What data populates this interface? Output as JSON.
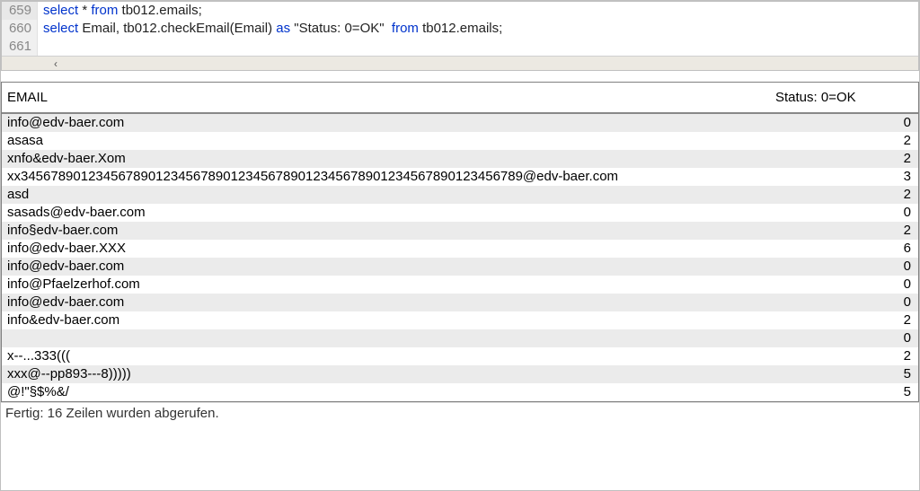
{
  "editor": {
    "lines": [
      {
        "num": "659",
        "tokens": [
          {
            "t": "select",
            "c": "kw"
          },
          {
            "t": " * ",
            "c": "plain"
          },
          {
            "t": "from",
            "c": "kw"
          },
          {
            "t": " tb012.emails;",
            "c": "plain"
          }
        ]
      },
      {
        "num": "660",
        "tokens": [
          {
            "t": "select",
            "c": "kw"
          },
          {
            "t": " Email, tb012.checkEmail(Email) ",
            "c": "plain"
          },
          {
            "t": "as",
            "c": "kw"
          },
          {
            "t": " \"Status: 0=OK\"  ",
            "c": "str"
          },
          {
            "t": "from",
            "c": "kw"
          },
          {
            "t": " tb012.emails;",
            "c": "plain"
          }
        ]
      },
      {
        "num": "661",
        "tokens": []
      }
    ],
    "scroll_glyph": "‹"
  },
  "grid": {
    "columns": {
      "email": "EMAIL",
      "status": "Status: 0=OK"
    },
    "rows": [
      {
        "email": "info@edv-baer.com",
        "status": "0"
      },
      {
        "email": "asasa",
        "status": "2"
      },
      {
        "email": "xnfo&edv-baer.Xom",
        "status": "2"
      },
      {
        "email": "xx3456789012345678901234567890123456789012345678901234567890123456789@edv-baer.com",
        "status": "3"
      },
      {
        "email": "asd",
        "status": "2"
      },
      {
        "email": "sasads@edv-baer.com",
        "status": "0"
      },
      {
        "email": "info§edv-baer.com",
        "status": "2"
      },
      {
        "email": "info@edv-baer.XXX",
        "status": "6"
      },
      {
        "email": "info@edv-baer.com",
        "status": "0"
      },
      {
        "email": "info@Pfaelzerhof.com",
        "status": "0"
      },
      {
        "email": "info@edv-baer.com",
        "status": "0"
      },
      {
        "email": "info&edv-baer.com",
        "status": "2"
      },
      {
        "email": "",
        "status": "0"
      },
      {
        "email": "x--...333(((",
        "status": "2"
      },
      {
        "email": "xxx@--pp893---8)))))",
        "status": "5"
      },
      {
        "email": " @!\"§$%&/",
        "status": "5"
      }
    ]
  },
  "status_text": "Fertig: 16 Zeilen wurden abgerufen."
}
